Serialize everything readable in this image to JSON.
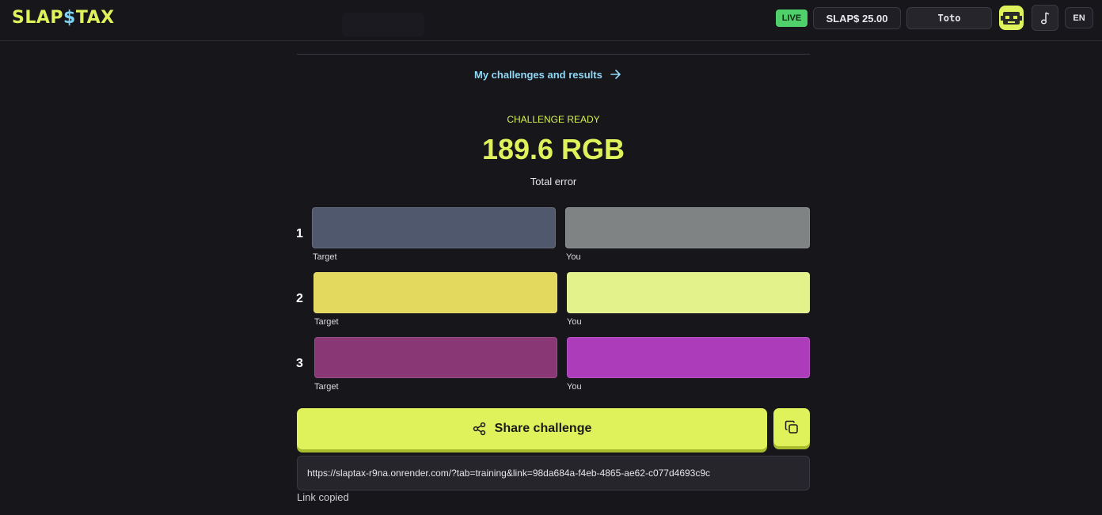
{
  "header": {
    "logo_left": "SLAP",
    "logo_dollar": "$",
    "logo_right": "TAX",
    "live_label": "LIVE",
    "balance": "SLAP$ 25.00",
    "username": "Toto",
    "language": "EN"
  },
  "main": {
    "challenges_link": "My challenges and results",
    "status": "CHALLENGE READY",
    "total_error_value": "189.6 RGB",
    "total_error_label": "Total error",
    "rows": [
      {
        "number": "1",
        "target_label": "Target",
        "you_label": "You",
        "target_color": "#4f586d",
        "you_color": "#808384"
      },
      {
        "number": "2",
        "target_label": "Target",
        "you_label": "You",
        "target_color": "#e3d95e",
        "you_color": "#e3f28a"
      },
      {
        "number": "3",
        "target_label": "Target",
        "you_label": "You",
        "target_color": "#8a3776",
        "you_color": "#ad3cbb"
      }
    ],
    "share_label": "Share challenge",
    "share_url": "https://slaptax-r9na.onrender.com/?tab=training&link=98da684a-f4eb-4865-ae62-c077d4693c9c",
    "link_copied": "Link copied"
  },
  "colors": {
    "accent": "#dff25b",
    "link": "#8fd8f5",
    "live": "#4fd06a",
    "background": "#17161b"
  }
}
